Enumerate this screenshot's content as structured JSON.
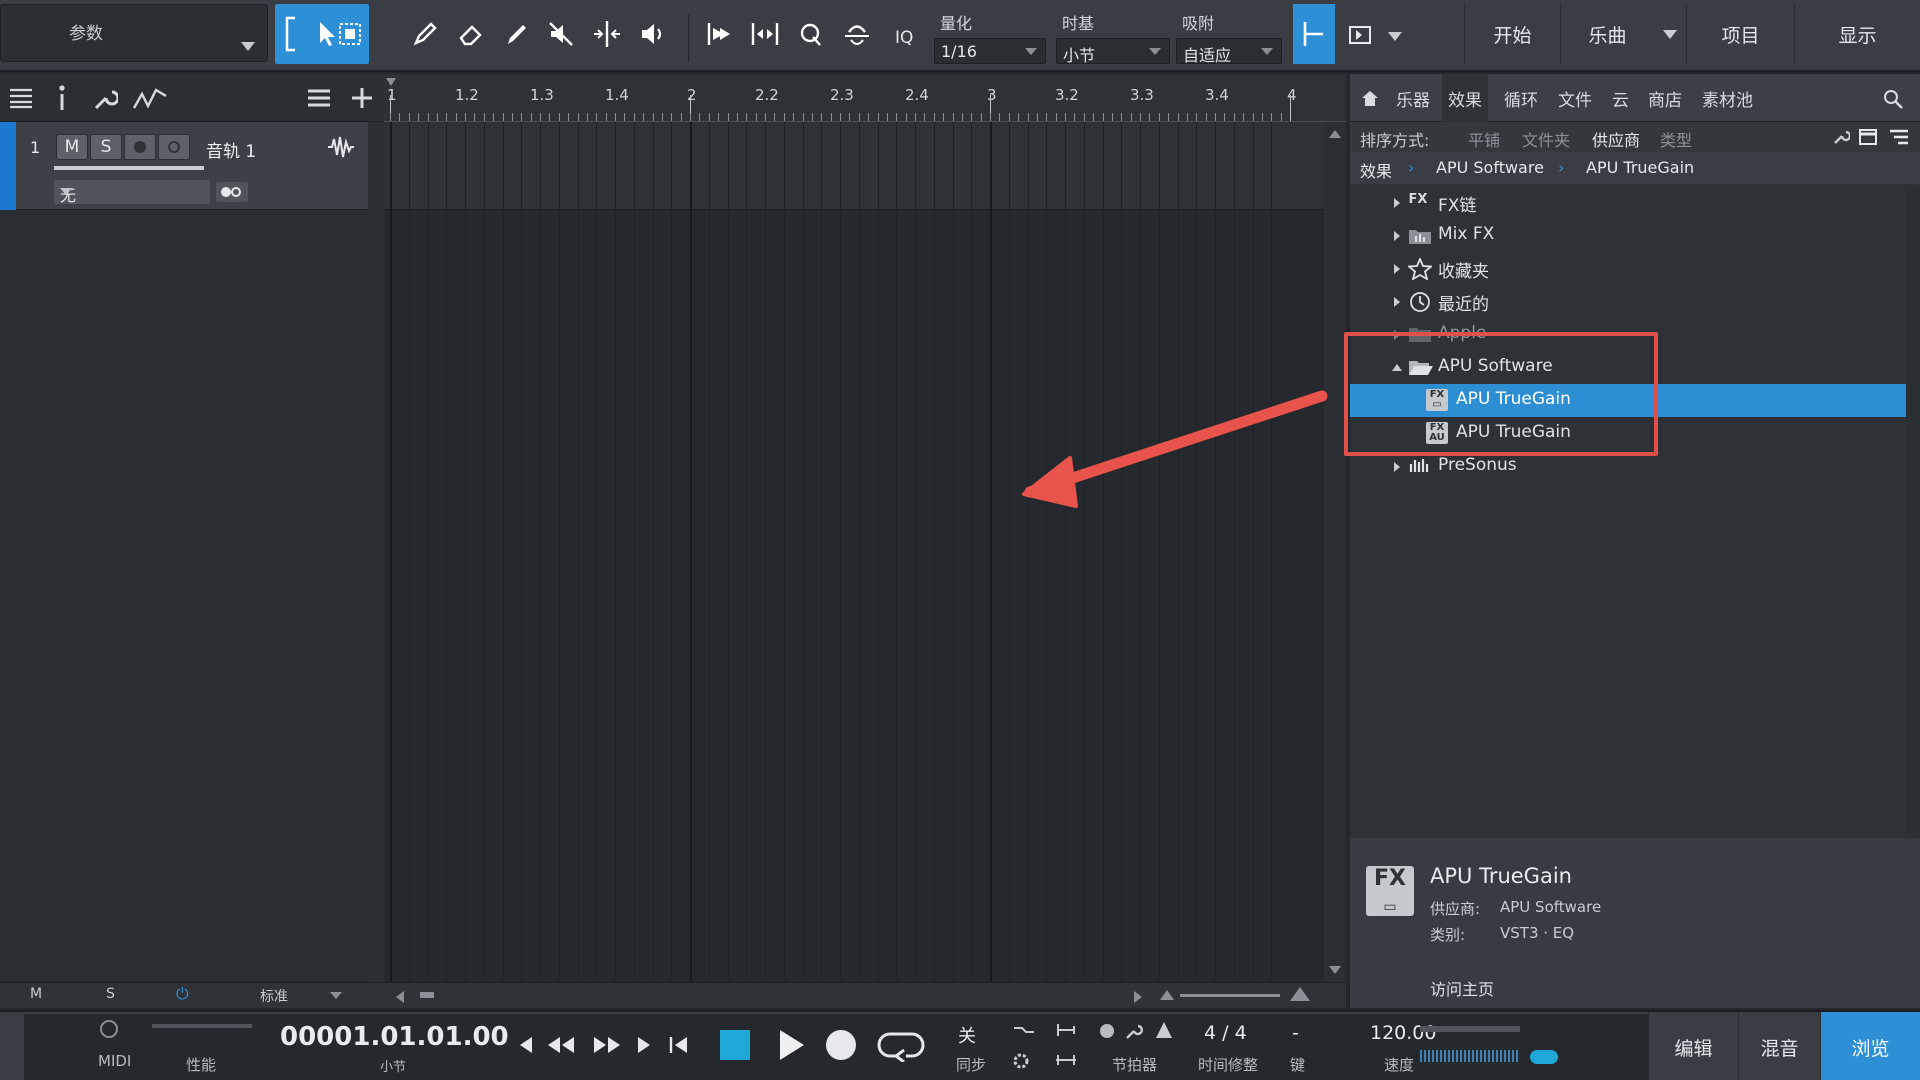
{
  "toolbar": {
    "params_label": "参数",
    "iq_label": "IQ",
    "quantize": {
      "title": "量化",
      "value": "1/16"
    },
    "timebase": {
      "title": "时基",
      "value": "小节"
    },
    "snap": {
      "title": "吸附",
      "value": "自适应"
    },
    "nav": [
      "开始",
      "乐曲",
      "项目",
      "显示"
    ]
  },
  "track": {
    "number": "1",
    "mute": "M",
    "solo": "S",
    "name": "音轨 1",
    "input": "无"
  },
  "ruler": {
    "labels": [
      "1",
      "1.2",
      "1.3",
      "1.4",
      "2",
      "2.2",
      "2.3",
      "2.4",
      "3",
      "3.2",
      "3.3",
      "3.4",
      "4"
    ]
  },
  "browser": {
    "tabs": [
      "乐器",
      "效果",
      "循环",
      "文件",
      "云",
      "商店",
      "素材池"
    ],
    "active_tab": "效果",
    "sort": {
      "label": "排序方式:",
      "options": [
        "平铺",
        "文件夹",
        "供应商",
        "类型"
      ],
      "active": "供应商"
    },
    "breadcrumb": [
      "效果",
      "APU Software",
      "APU TrueGain"
    ],
    "tree": [
      {
        "label": "FX链",
        "icon": "fx-chain-icon"
      },
      {
        "label": "Mix FX",
        "icon": "mix-fx-icon"
      },
      {
        "label": "收藏夹",
        "icon": "star-icon"
      },
      {
        "label": "最近的",
        "icon": "clock-icon"
      },
      {
        "label": "Apple",
        "icon": "folder-icon"
      },
      {
        "label": "APU Software",
        "icon": "folder-open-icon"
      },
      {
        "label": "APU TrueGain",
        "icon": "fx-vst3-icon"
      },
      {
        "label": "APU TrueGain",
        "icon": "fx-au-icon"
      },
      {
        "label": "PreSonus",
        "icon": "presonus-icon"
      }
    ],
    "info": {
      "badge": "FX",
      "title": "APU TrueGain",
      "vendor_key": "供应商:",
      "vendor": "APU Software",
      "type_key": "类别:",
      "type": "VST3 · EQ",
      "link": "访问主页"
    }
  },
  "lowbar": {
    "m": "M",
    "s": "S",
    "mode": "标准"
  },
  "transport": {
    "midi": "MIDI",
    "perf": "性能",
    "position": "00001.01.01.00",
    "position_unit": "小节",
    "sync_value": "关",
    "sync_label": "同步",
    "metronome_label": "节拍器",
    "signature": "4 / 4",
    "signature_label": "时间修整",
    "key_value": "-",
    "key_label": "键",
    "tempo": "120.00",
    "tempo_label": "速度"
  },
  "bottom_nav": [
    "编辑",
    "混音",
    "浏览"
  ],
  "colors": {
    "accent": "#2d90d6",
    "highlight": "#e2504a",
    "arrow": "#e8534c"
  }
}
